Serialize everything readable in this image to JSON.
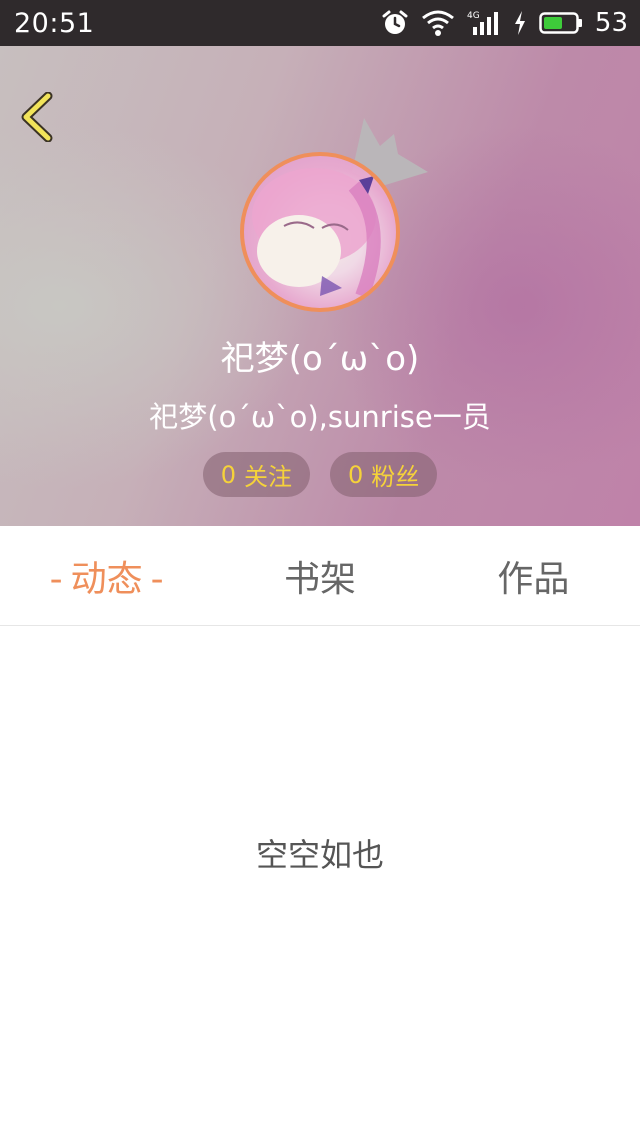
{
  "status_bar": {
    "time": "20:51",
    "network": "4G",
    "battery_percent": "53",
    "icons": [
      "alarm-icon",
      "wifi-icon",
      "signal-icon",
      "charging-icon",
      "battery-icon"
    ]
  },
  "header": {
    "back_icon": "chevron-left-icon",
    "username": "祀梦(o´ω`o)",
    "subtitle": "祀梦(o´ω`o),sunrise一员",
    "stats": {
      "following_count": "0",
      "following_label": "关注",
      "followers_count": "0",
      "followers_label": "粉丝"
    },
    "colors": {
      "accent": "#ef8f5b",
      "stat_text": "#f5d23a",
      "back_icon": "#f2e45a"
    }
  },
  "tabs": {
    "items": [
      {
        "label": "动态",
        "active": true
      },
      {
        "label": "书架",
        "active": false
      },
      {
        "label": "作品",
        "active": false
      }
    ],
    "active_dash": "-"
  },
  "content": {
    "empty_text": "空空如也"
  }
}
